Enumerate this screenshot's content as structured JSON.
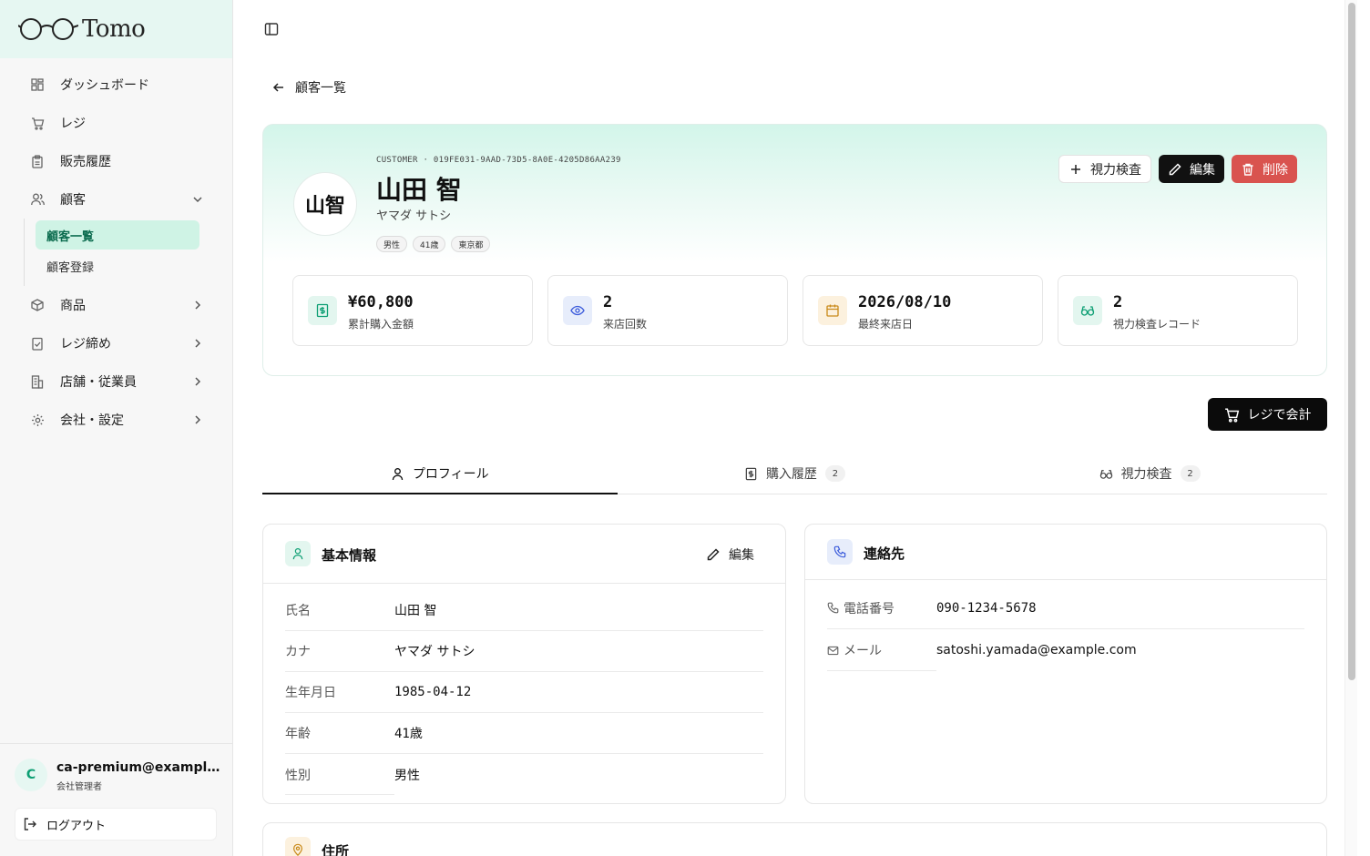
{
  "app": {
    "name": "Tomo"
  },
  "sidebar": {
    "items": [
      {
        "label": "ダッシュボード",
        "icon": "dashboard-icon"
      },
      {
        "label": "レジ",
        "icon": "cart-icon"
      },
      {
        "label": "販売履歴",
        "icon": "clipboard-icon"
      },
      {
        "label": "顧客",
        "icon": "users-icon",
        "expanded": true
      },
      {
        "label": "商品",
        "icon": "box-icon"
      },
      {
        "label": "レジ締め",
        "icon": "clipboard-check-icon"
      },
      {
        "label": "店舗・従業員",
        "icon": "building-icon"
      },
      {
        "label": "会社・設定",
        "icon": "gear-icon"
      }
    ],
    "customer_sub": [
      {
        "label": "顧客一覧",
        "active": true
      },
      {
        "label": "顧客登録",
        "active": false
      }
    ],
    "user": {
      "initial": "C",
      "email": "ca-premium@example.com",
      "role": "会社管理者",
      "logout_label": "ログアウト"
    }
  },
  "back_label": "顧客一覧",
  "customer": {
    "id_line": "CUSTOMER · 019FE031-9AAD-73D5-8A0E-4205D86AA239",
    "avatar_text": "山智",
    "name": "山田 智",
    "kana": "ヤマダ サトシ",
    "tags": [
      "男性",
      "41歳",
      "東京都"
    ]
  },
  "actions": {
    "exam_label": "視力検査",
    "edit_label": "編集",
    "delete_label": "削除"
  },
  "stats": [
    {
      "value": "¥60,800",
      "label": "累計購入金額",
      "icon": "receipt-icon",
      "color": "#e3f6ef"
    },
    {
      "value": "2",
      "label": "来店回数",
      "icon": "eye-icon",
      "color": "#e7edfb"
    },
    {
      "value": "2026/08/10",
      "label": "最終来店日",
      "icon": "calendar-icon",
      "color": "#fcf1de"
    },
    {
      "value": "2",
      "label": "視力検査レコード",
      "icon": "glasses-icon",
      "color": "#e3f6ef"
    }
  ],
  "pay_label": "レジで会計",
  "tabs": [
    {
      "label": "プロフィール",
      "badge": null,
      "active": true
    },
    {
      "label": "購入履歴",
      "badge": "2",
      "active": false
    },
    {
      "label": "視力検査",
      "badge": "2",
      "active": false
    }
  ],
  "basic_info": {
    "title": "基本情報",
    "edit_label": "編集",
    "rows": [
      {
        "key": "氏名",
        "value": "山田 智"
      },
      {
        "key": "カナ",
        "value": "ヤマダ サトシ"
      },
      {
        "key": "生年月日",
        "value": "1985-04-12"
      },
      {
        "key": "年齢",
        "value": "41歳"
      },
      {
        "key": "性別",
        "value": "男性"
      }
    ]
  },
  "contact": {
    "title": "連絡先",
    "rows": [
      {
        "key": "電話番号",
        "value": "090-1234-5678"
      },
      {
        "key": "メール",
        "value": "satoshi.yamada@example.com"
      }
    ]
  },
  "address": {
    "title": "住所"
  },
  "colors": {
    "accent": "#0e9f74",
    "accent_bg": "#cff3e5",
    "danger": "#d9534f",
    "dark": "#111111"
  }
}
